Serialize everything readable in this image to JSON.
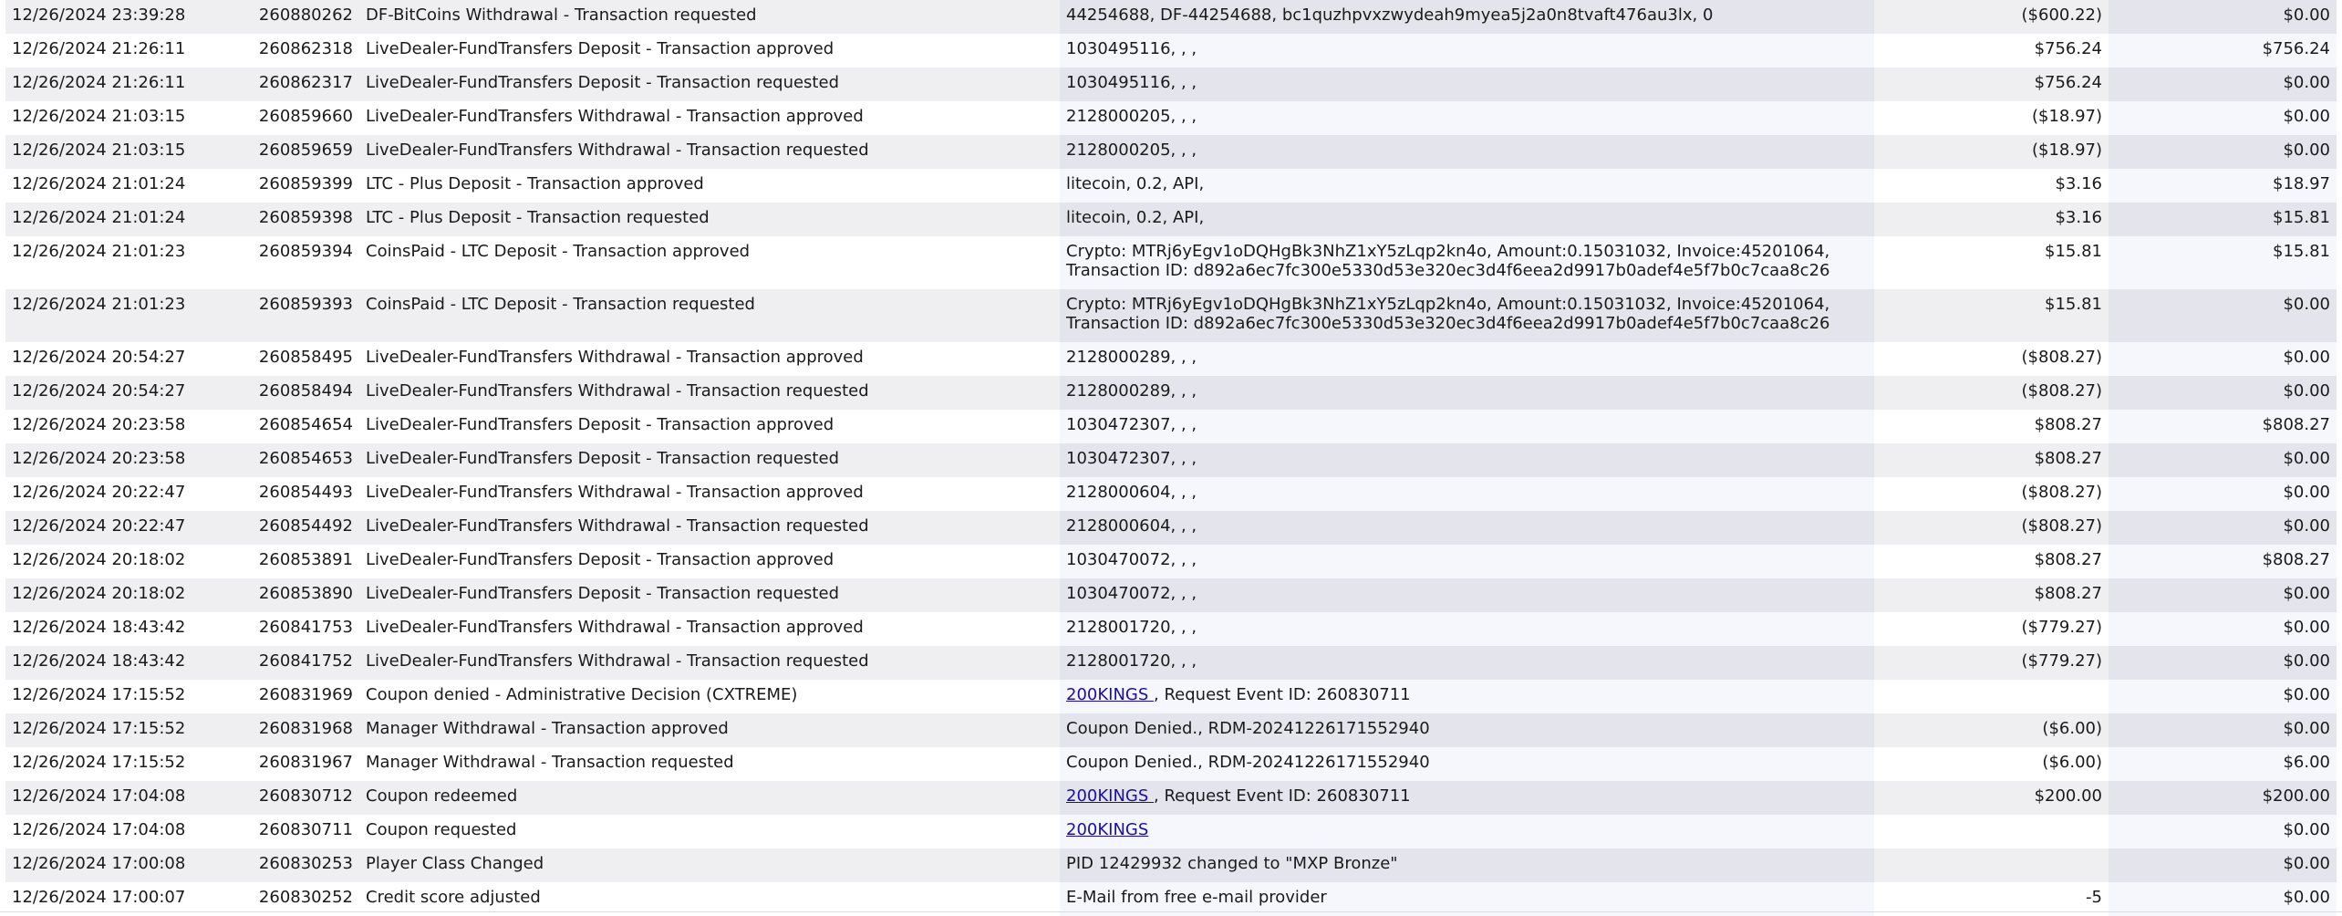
{
  "transactions": [
    {
      "date": "12/26/2024 23:39:28",
      "id": "260880262",
      "description": "DF-BitCoins Withdrawal - Transaction requested",
      "details": "44254688, DF-44254688, bc1quzhpvxzwydeah9myea5j2a0n8tvaft476au3lx, 0",
      "amount": "($600.22)",
      "balance": "$0.00"
    },
    {
      "date": "12/26/2024 21:26:11",
      "id": "260862318",
      "description": "LiveDealer-FundTransfers Deposit - Transaction approved",
      "details": "1030495116, , ,",
      "amount": "$756.24",
      "balance": "$756.24"
    },
    {
      "date": "12/26/2024 21:26:11",
      "id": "260862317",
      "description": "LiveDealer-FundTransfers Deposit - Transaction requested",
      "details": "1030495116, , ,",
      "amount": "$756.24",
      "balance": "$0.00"
    },
    {
      "date": "12/26/2024 21:03:15",
      "id": "260859660",
      "description": "LiveDealer-FundTransfers Withdrawal - Transaction approved",
      "details": "2128000205, , ,",
      "amount": "($18.97)",
      "balance": "$0.00"
    },
    {
      "date": "12/26/2024 21:03:15",
      "id": "260859659",
      "description": "LiveDealer-FundTransfers Withdrawal - Transaction requested",
      "details": "2128000205, , ,",
      "amount": "($18.97)",
      "balance": "$0.00"
    },
    {
      "date": "12/26/2024 21:01:24",
      "id": "260859399",
      "description": "LTC - Plus Deposit - Transaction approved",
      "details": "litecoin, 0.2, API,",
      "amount": "$3.16",
      "balance": "$18.97"
    },
    {
      "date": "12/26/2024 21:01:24",
      "id": "260859398",
      "description": "LTC - Plus Deposit - Transaction requested",
      "details": "litecoin, 0.2, API,",
      "amount": "$3.16",
      "balance": "$15.81"
    },
    {
      "date": "12/26/2024 21:01:23",
      "id": "260859394",
      "description": "CoinsPaid - LTC Deposit - Transaction approved",
      "details": "Crypto: MTRj6yEgv1oDQHgBk3NhZ1xY5zLqp2kn4o, Amount:0.15031032, Invoice:45201064,",
      "details2": "Transaction ID: d892a6ec7fc300e5330d53e320ec3d4f6eea2d9917b0adef4e5f7b0c7caa8c26",
      "amount": "$15.81",
      "balance": "$15.81"
    },
    {
      "date": "12/26/2024 21:01:23",
      "id": "260859393",
      "description": "CoinsPaid - LTC Deposit - Transaction requested",
      "details": "Crypto: MTRj6yEgv1oDQHgBk3NhZ1xY5zLqp2kn4o, Amount:0.15031032, Invoice:45201064,",
      "details2": "Transaction ID: d892a6ec7fc300e5330d53e320ec3d4f6eea2d9917b0adef4e5f7b0c7caa8c26",
      "amount": "$15.81",
      "balance": "$0.00"
    },
    {
      "date": "12/26/2024 20:54:27",
      "id": "260858495",
      "description": "LiveDealer-FundTransfers Withdrawal - Transaction approved",
      "details": "2128000289, , ,",
      "amount": "($808.27)",
      "balance": "$0.00"
    },
    {
      "date": "12/26/2024 20:54:27",
      "id": "260858494",
      "description": "LiveDealer-FundTransfers Withdrawal - Transaction requested",
      "details": "2128000289, , ,",
      "amount": "($808.27)",
      "balance": "$0.00"
    },
    {
      "date": "12/26/2024 20:23:58",
      "id": "260854654",
      "description": "LiveDealer-FundTransfers Deposit - Transaction approved",
      "details": "1030472307, , ,",
      "amount": "$808.27",
      "balance": "$808.27"
    },
    {
      "date": "12/26/2024 20:23:58",
      "id": "260854653",
      "description": "LiveDealer-FundTransfers Deposit - Transaction requested",
      "details": "1030472307, , ,",
      "amount": "$808.27",
      "balance": "$0.00"
    },
    {
      "date": "12/26/2024 20:22:47",
      "id": "260854493",
      "description": "LiveDealer-FundTransfers Withdrawal - Transaction approved",
      "details": "2128000604, , ,",
      "amount": "($808.27)",
      "balance": "$0.00"
    },
    {
      "date": "12/26/2024 20:22:47",
      "id": "260854492",
      "description": "LiveDealer-FundTransfers Withdrawal - Transaction requested",
      "details": "2128000604, , ,",
      "amount": "($808.27)",
      "balance": "$0.00"
    },
    {
      "date": "12/26/2024 20:18:02",
      "id": "260853891",
      "description": "LiveDealer-FundTransfers Deposit - Transaction approved",
      "details": "1030470072, , ,",
      "amount": "$808.27",
      "balance": "$808.27"
    },
    {
      "date": "12/26/2024 20:18:02",
      "id": "260853890",
      "description": "LiveDealer-FundTransfers Deposit - Transaction requested",
      "details": "1030470072, , ,",
      "amount": "$808.27",
      "balance": "$0.00"
    },
    {
      "date": "12/26/2024 18:43:42",
      "id": "260841753",
      "description": "LiveDealer-FundTransfers Withdrawal - Transaction approved",
      "details": "2128001720, , ,",
      "amount": "($779.27)",
      "balance": "$0.00"
    },
    {
      "date": "12/26/2024 18:43:42",
      "id": "260841752",
      "description": "LiveDealer-FundTransfers Withdrawal - Transaction requested",
      "details": "2128001720, , ,",
      "amount": "($779.27)",
      "balance": "$0.00"
    },
    {
      "date": "12/26/2024 17:15:52",
      "id": "260831969",
      "description": "Coupon denied - Administrative Decision (CXTREME)",
      "details_link": "200KINGS ",
      "details": ", Request Event ID: 260830711",
      "amount": "",
      "balance": "$0.00"
    },
    {
      "date": "12/26/2024 17:15:52",
      "id": "260831968",
      "description": "Manager Withdrawal - Transaction approved",
      "details": "Coupon Denied., RDM-20241226171552940",
      "amount": "($6.00)",
      "balance": "$0.00"
    },
    {
      "date": "12/26/2024 17:15:52",
      "id": "260831967",
      "description": "Manager Withdrawal - Transaction requested",
      "details": "Coupon Denied., RDM-20241226171552940",
      "amount": "($6.00)",
      "balance": "$6.00"
    },
    {
      "date": "12/26/2024 17:04:08",
      "id": "260830712",
      "description": "Coupon redeemed",
      "details_link": "200KINGS ",
      "details": ", Request Event ID: 260830711",
      "amount": "$200.00",
      "balance": "$200.00"
    },
    {
      "date": "12/26/2024 17:04:08",
      "id": "260830711",
      "description": "Coupon requested",
      "details_link": "200KINGS",
      "details": "",
      "amount": "",
      "balance": "$0.00"
    },
    {
      "date": "12/26/2024 17:00:08",
      "id": "260830253",
      "description": "Player Class Changed",
      "details": "PID 12429932 changed to \"MXP Bronze\"",
      "amount": "",
      "balance": "$0.00"
    },
    {
      "date": "12/26/2024 17:00:07",
      "id": "260830252",
      "description": "Credit score adjusted",
      "details": "E-Mail from free e-mail provider",
      "amount": "-5",
      "balance": "$0.00"
    }
  ],
  "colors": {
    "row_alt": "#efeff2",
    "row_plain": "#ffffff",
    "link": "#1a0dab"
  }
}
